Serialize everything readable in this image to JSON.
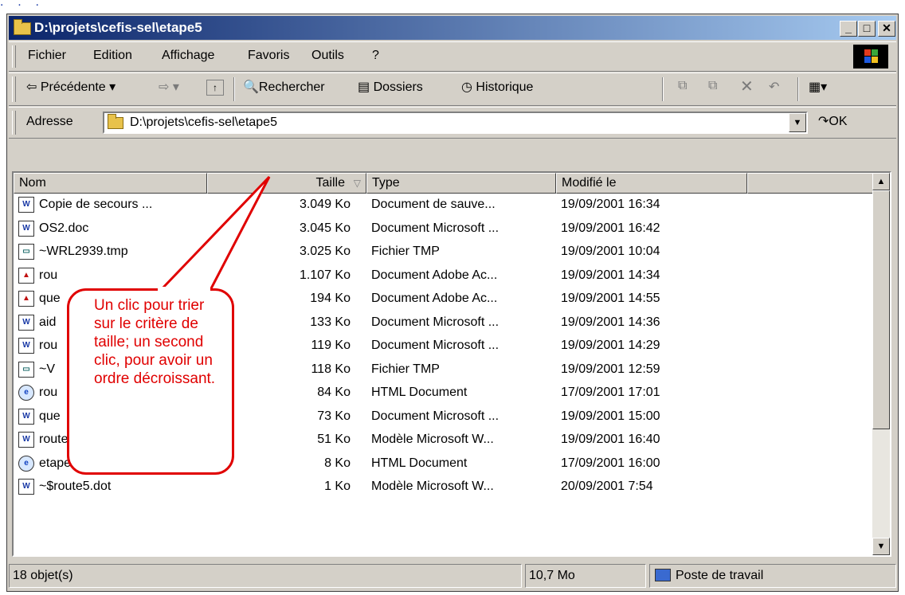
{
  "window": {
    "title": "D:\\projets\\cefis-sel\\etape5"
  },
  "menu": [
    {
      "label": "Fichier"
    },
    {
      "label": "Edition"
    },
    {
      "label": "Affichage"
    },
    {
      "label": "Favoris"
    },
    {
      "label": "Outils"
    },
    {
      "label": "?"
    }
  ],
  "toolbar": {
    "back_label": "Précédente",
    "search_label": "Rechercher",
    "folders_label": "Dossiers",
    "history_label": "Historique"
  },
  "address": {
    "label": "Adresse",
    "value": "D:\\projets\\cefis-sel\\etape5",
    "go_label": "OK"
  },
  "columns": {
    "name": "Nom",
    "size": "Taille",
    "type": "Type",
    "modified": "Modifié le"
  },
  "files": [
    {
      "icon": "word-backup-icon",
      "name": "Copie de secours ...",
      "size": "3.049 Ko",
      "type": "Document de sauve...",
      "modified": "19/09/2001 16:34"
    },
    {
      "icon": "word-doc-icon",
      "name": "OS2.doc",
      "size": "3.045 Ko",
      "type": "Document Microsoft ...",
      "modified": "19/09/2001 16:42"
    },
    {
      "icon": "tmp-file-icon",
      "name": "~WRL2939.tmp",
      "size": "3.025 Ko",
      "type": "Fichier TMP",
      "modified": "19/09/2001 10:04"
    },
    {
      "icon": "pdf-icon",
      "name": "rou",
      "size": "1.107 Ko",
      "type": "Document Adobe Ac...",
      "modified": "19/09/2001 14:34"
    },
    {
      "icon": "pdf-icon",
      "name": "que",
      "size": "194 Ko",
      "type": "Document Adobe Ac...",
      "modified": "19/09/2001 14:55"
    },
    {
      "icon": "word-doc-icon",
      "name": "aid",
      "size": "133 Ko",
      "type": "Document Microsoft ...",
      "modified": "19/09/2001 14:36"
    },
    {
      "icon": "word-doc-icon",
      "name": "rou",
      "size": "119 Ko",
      "type": "Document Microsoft ...",
      "modified": "19/09/2001 14:29"
    },
    {
      "icon": "tmp-file-icon",
      "name": "~V",
      "size": "118 Ko",
      "type": "Fichier TMP",
      "modified": "19/09/2001 12:59"
    },
    {
      "icon": "html-icon",
      "name": "rou",
      "size": "84 Ko",
      "type": "HTML Document",
      "modified": "17/09/2001 17:01"
    },
    {
      "icon": "word-doc-icon",
      "name": "que",
      "size": "73 Ko",
      "type": "Document Microsoft ...",
      "modified": "19/09/2001 15:00"
    },
    {
      "icon": "word-template-icon",
      "name": "route5.dot",
      "size": "51 Ko",
      "type": "Modèle Microsoft W...",
      "modified": "19/09/2001 16:40"
    },
    {
      "icon": "html-icon",
      "name": "etape5.htm",
      "size": "8 Ko",
      "type": "HTML Document",
      "modified": "17/09/2001 16:00"
    },
    {
      "icon": "word-template-icon",
      "name": "~$route5.dot",
      "size": "1 Ko",
      "type": "Modèle Microsoft W...",
      "modified": "20/09/2001 7:54"
    }
  ],
  "callout": {
    "text": "Un clic pour trier sur le critère de taille; un second clic, pour avoir un ordre décroissant."
  },
  "status": {
    "count": "18 objet(s)",
    "size": "10,7 Mo",
    "zone": "Poste de travail"
  }
}
